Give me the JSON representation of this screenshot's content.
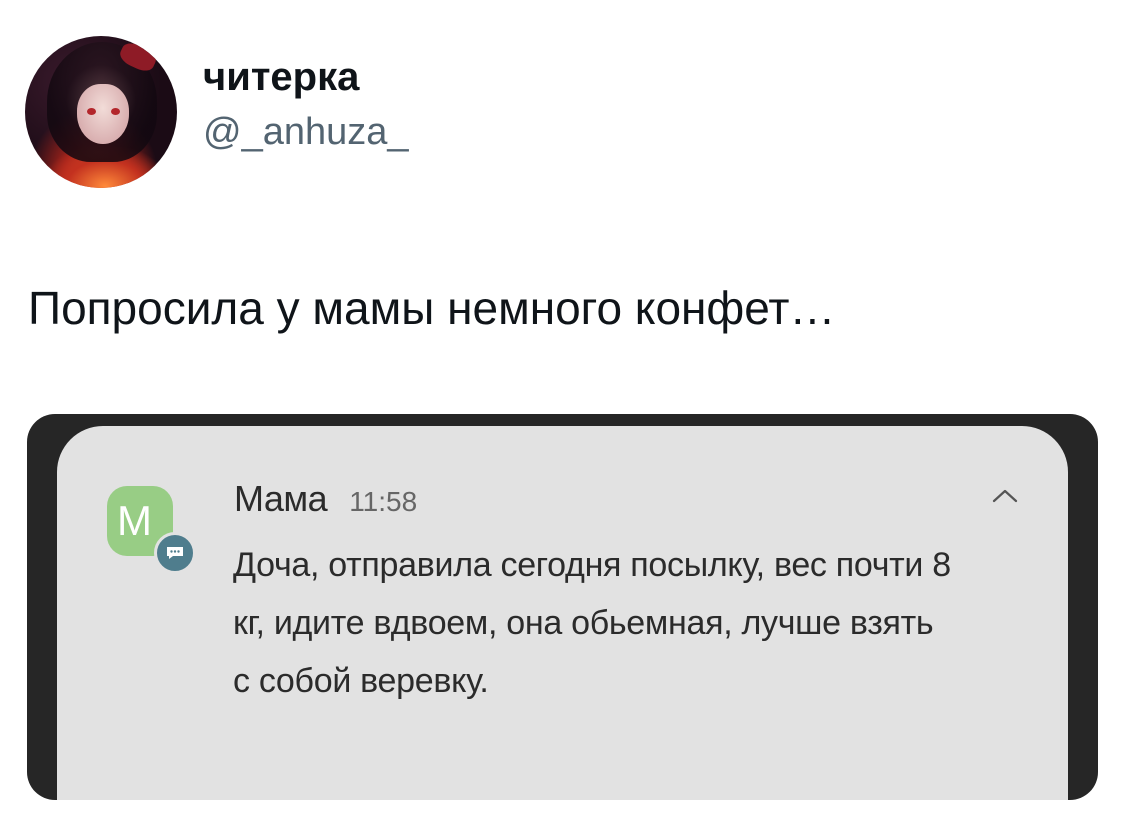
{
  "tweet": {
    "display_name": "читерка",
    "handle": "@_anhuza_",
    "text": "Попросила у мамы немного конфет…"
  },
  "notification": {
    "app_icon_letter": "M",
    "sender": "Мама",
    "time": "11:58",
    "message": "Доча, отправила сегодня посылку, вес почти 8 кг, идите вдвоем, она обьемная, лучше взять с собой веревку.",
    "icons": {
      "badge": "chat-bubble-icon",
      "collapse": "chevron-up-icon"
    },
    "colors": {
      "card": "#e2e2e2",
      "frame": "#262626",
      "app_icon": "#98cd85",
      "badge": "#4f7d8d"
    }
  }
}
